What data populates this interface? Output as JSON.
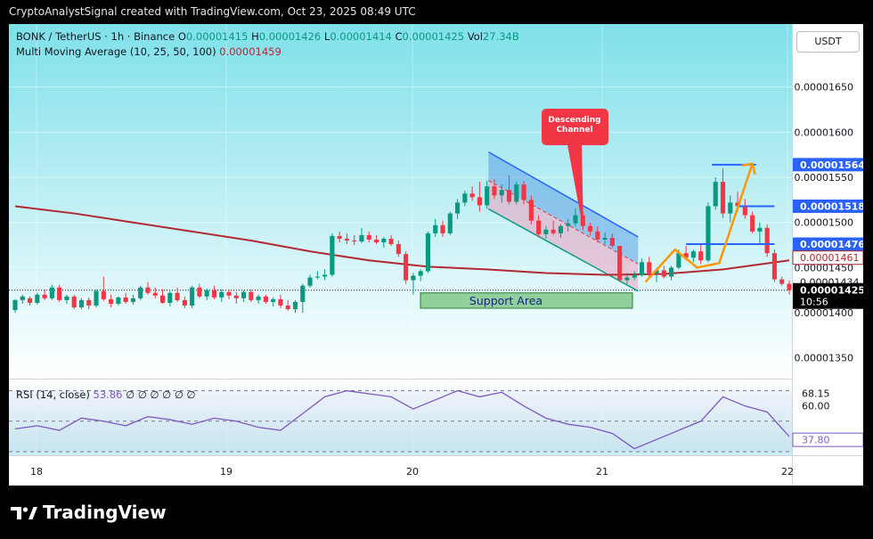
{
  "header": {
    "title": "CryptoAnalystSignal created with TradingView.com, Oct 23, 2025 08:49 UTC"
  },
  "legend": {
    "symbol": "BONK / TetherUS · 1h · Binance",
    "o_label": "O",
    "o_value": "0.00001415",
    "h_label": "H",
    "h_value": "0.00001426",
    "l_label": "L",
    "l_value": "0.00001414",
    "c_label": "C",
    "c_value": "0.00001425",
    "vol_label": "Vol",
    "vol_value": "27.34B",
    "ma_label": "Multi Moving Average (10, 25, 50, 100)",
    "ma_value": "0.00001459",
    "rsi_label": "RSI (14, close)",
    "rsi_value": "53.86",
    "rsi_extra": "∅ ∅ ∅ ∅ ∅ ∅"
  },
  "currency": "USDT",
  "footer": {
    "brand": "TradingView"
  },
  "chart_data": {
    "type": "candlestick",
    "x_ticks": [
      "18",
      "19",
      "20",
      "21",
      "22"
    ],
    "y_ticks": [
      "0.00001650",
      "0.00001600",
      "0.00001550",
      "0.00001500",
      "0.00001450",
      "0.00001400",
      "0.00001350"
    ],
    "ylim": [
      1.33e-05,
      1.7e-05
    ],
    "price_labels": [
      {
        "value": 1.564e-05,
        "text": "0.00001564",
        "style": "level"
      },
      {
        "value": 1.518e-05,
        "text": "0.00001518",
        "style": "level"
      },
      {
        "value": 1.476e-05,
        "text": "0.00001476",
        "style": "level"
      },
      {
        "value": 1.461e-05,
        "text": "0.00001461",
        "style": "ma"
      },
      {
        "value": 1.434e-05,
        "text": "0.00001434",
        "style": "plain"
      },
      {
        "value": 1.425e-05,
        "text": "0.00001425",
        "style": "last",
        "countdown": "10:56"
      }
    ],
    "annotations": {
      "channel_label": "Descending\nChannel",
      "support_label": "Support Area"
    },
    "candles": [
      [
        1403,
        1415,
        1400,
        1414
      ],
      [
        1414,
        1420,
        1410,
        1418
      ],
      [
        1416,
        1418,
        1408,
        1411
      ],
      [
        1411,
        1422,
        1409,
        1420
      ],
      [
        1420,
        1426,
        1414,
        1416
      ],
      [
        1416,
        1431,
        1414,
        1428
      ],
      [
        1428,
        1431,
        1412,
        1414
      ],
      [
        1414,
        1420,
        1410,
        1418
      ],
      [
        1418,
        1420,
        1404,
        1406
      ],
      [
        1406,
        1416,
        1404,
        1414
      ],
      [
        1414,
        1417,
        1404,
        1408
      ],
      [
        1408,
        1426,
        1406,
        1424
      ],
      [
        1424,
        1440,
        1413,
        1415
      ],
      [
        1415,
        1420,
        1406,
        1410
      ],
      [
        1410,
        1418,
        1408,
        1417
      ],
      [
        1417,
        1422,
        1410,
        1412
      ],
      [
        1412,
        1420,
        1409,
        1416
      ],
      [
        1416,
        1430,
        1414,
        1428
      ],
      [
        1428,
        1434,
        1420,
        1422
      ],
      [
        1422,
        1428,
        1416,
        1419
      ],
      [
        1419,
        1426,
        1410,
        1411
      ],
      [
        1411,
        1424,
        1407,
        1422
      ],
      [
        1422,
        1428,
        1412,
        1414
      ],
      [
        1414,
        1418,
        1405,
        1408
      ],
      [
        1408,
        1430,
        1405,
        1428
      ],
      [
        1428,
        1432,
        1416,
        1418
      ],
      [
        1418,
        1427,
        1414,
        1425
      ],
      [
        1425,
        1430,
        1415,
        1417
      ],
      [
        1417,
        1426,
        1412,
        1423
      ],
      [
        1423,
        1426,
        1415,
        1419
      ],
      [
        1419,
        1423,
        1410,
        1416
      ],
      [
        1416,
        1425,
        1412,
        1423
      ],
      [
        1423,
        1426,
        1412,
        1414
      ],
      [
        1414,
        1420,
        1410,
        1418
      ],
      [
        1418,
        1420,
        1410,
        1412
      ],
      [
        1412,
        1417,
        1407,
        1415
      ],
      [
        1415,
        1420,
        1405,
        1408
      ],
      [
        1408,
        1414,
        1402,
        1404
      ],
      [
        1404,
        1414,
        1400,
        1412
      ],
      [
        1412,
        1432,
        1400,
        1430
      ],
      [
        1430,
        1442,
        1428,
        1439
      ],
      [
        1439,
        1446,
        1437,
        1440
      ],
      [
        1440,
        1448,
        1436,
        1442
      ],
      [
        1442,
        1488,
        1440,
        1485
      ],
      [
        1485,
        1490,
        1478,
        1482
      ],
      [
        1482,
        1488,
        1476,
        1480
      ],
      [
        1480,
        1486,
        1475,
        1479
      ],
      [
        1479,
        1494,
        1477,
        1486
      ],
      [
        1486,
        1490,
        1478,
        1481
      ],
      [
        1481,
        1486,
        1476,
        1478
      ],
      [
        1478,
        1484,
        1472,
        1482
      ],
      [
        1482,
        1486,
        1474,
        1476
      ],
      [
        1476,
        1480,
        1462,
        1465
      ],
      [
        1465,
        1468,
        1432,
        1436
      ],
      [
        1436,
        1444,
        1420,
        1441
      ],
      [
        1441,
        1448,
        1435,
        1446
      ],
      [
        1446,
        1490,
        1444,
        1488
      ],
      [
        1488,
        1504,
        1484,
        1497
      ],
      [
        1497,
        1502,
        1484,
        1488
      ],
      [
        1488,
        1512,
        1486,
        1510
      ],
      [
        1510,
        1526,
        1504,
        1522
      ],
      [
        1522,
        1535,
        1518,
        1532
      ],
      [
        1532,
        1540,
        1524,
        1528
      ],
      [
        1528,
        1545,
        1512,
        1519
      ],
      [
        1519,
        1546,
        1515,
        1540
      ],
      [
        1540,
        1548,
        1526,
        1530
      ],
      [
        1530,
        1542,
        1522,
        1536
      ],
      [
        1536,
        1552,
        1520,
        1523
      ],
      [
        1523,
        1545,
        1520,
        1542
      ],
      [
        1542,
        1546,
        1520,
        1525
      ],
      [
        1525,
        1530,
        1498,
        1502
      ],
      [
        1502,
        1508,
        1484,
        1487
      ],
      [
        1487,
        1496,
        1482,
        1492
      ],
      [
        1492,
        1502,
        1486,
        1488
      ],
      [
        1488,
        1498,
        1483,
        1496
      ],
      [
        1496,
        1504,
        1490,
        1499
      ],
      [
        1499,
        1516,
        1495,
        1508
      ],
      [
        1508,
        1512,
        1492,
        1496
      ],
      [
        1496,
        1500,
        1486,
        1490
      ],
      [
        1490,
        1496,
        1478,
        1481
      ],
      [
        1481,
        1489,
        1476,
        1483
      ],
      [
        1483,
        1488,
        1472,
        1474
      ],
      [
        1474,
        1474,
        1434,
        1436
      ],
      [
        1436,
        1444,
        1432,
        1439
      ],
      [
        1439,
        1446,
        1436,
        1442
      ],
      [
        1442,
        1460,
        1440,
        1456
      ],
      [
        1456,
        1462,
        1440,
        1444
      ],
      [
        1444,
        1450,
        1434,
        1447
      ],
      [
        1447,
        1452,
        1438,
        1440
      ],
      [
        1440,
        1452,
        1436,
        1450
      ],
      [
        1450,
        1470,
        1448,
        1466
      ],
      [
        1466,
        1474,
        1458,
        1461
      ],
      [
        1461,
        1470,
        1456,
        1468
      ],
      [
        1468,
        1476,
        1454,
        1458
      ],
      [
        1458,
        1522,
        1456,
        1518
      ],
      [
        1518,
        1550,
        1514,
        1545
      ],
      [
        1545,
        1560,
        1505,
        1510
      ],
      [
        1510,
        1530,
        1500,
        1522
      ],
      [
        1522,
        1534,
        1512,
        1518
      ],
      [
        1518,
        1526,
        1504,
        1508
      ],
      [
        1508,
        1512,
        1488,
        1490
      ],
      [
        1490,
        1500,
        1476,
        1494
      ],
      [
        1494,
        1498,
        1462,
        1466
      ],
      [
        1466,
        1470,
        1434,
        1437
      ],
      [
        1437,
        1440,
        1430,
        1432
      ],
      [
        1432,
        1436,
        1420,
        1425
      ]
    ],
    "ma_series": [
      [
        0,
        1518
      ],
      [
        8,
        1510
      ],
      [
        16,
        1500
      ],
      [
        24,
        1490
      ],
      [
        32,
        1480
      ],
      [
        40,
        1468
      ],
      [
        48,
        1458
      ],
      [
        56,
        1451
      ],
      [
        64,
        1448
      ],
      [
        72,
        1444
      ],
      [
        80,
        1442
      ],
      [
        88,
        1443
      ],
      [
        96,
        1448
      ],
      [
        105,
        1458
      ]
    ],
    "rsi": {
      "ylim": [
        30,
        75
      ],
      "levels": [
        "68.15",
        "60.00",
        "37.80"
      ],
      "series": [
        [
          0,
          45
        ],
        [
          3,
          47
        ],
        [
          6,
          44
        ],
        [
          9,
          52
        ],
        [
          12,
          50
        ],
        [
          15,
          47
        ],
        [
          18,
          53
        ],
        [
          21,
          51
        ],
        [
          24,
          48
        ],
        [
          27,
          52
        ],
        [
          30,
          50
        ],
        [
          33,
          46
        ],
        [
          36,
          44
        ],
        [
          39,
          55
        ],
        [
          42,
          66
        ],
        [
          45,
          70
        ],
        [
          48,
          68
        ],
        [
          51,
          66
        ],
        [
          54,
          58
        ],
        [
          57,
          64
        ],
        [
          60,
          70
        ],
        [
          63,
          66
        ],
        [
          66,
          69
        ],
        [
          69,
          60
        ],
        [
          72,
          52
        ],
        [
          75,
          48
        ],
        [
          78,
          46
        ],
        [
          81,
          42
        ],
        [
          84,
          32
        ],
        [
          87,
          38
        ],
        [
          90,
          44
        ],
        [
          93,
          50
        ],
        [
          96,
          66
        ],
        [
          99,
          60
        ],
        [
          102,
          56
        ],
        [
          105,
          40
        ]
      ]
    }
  }
}
